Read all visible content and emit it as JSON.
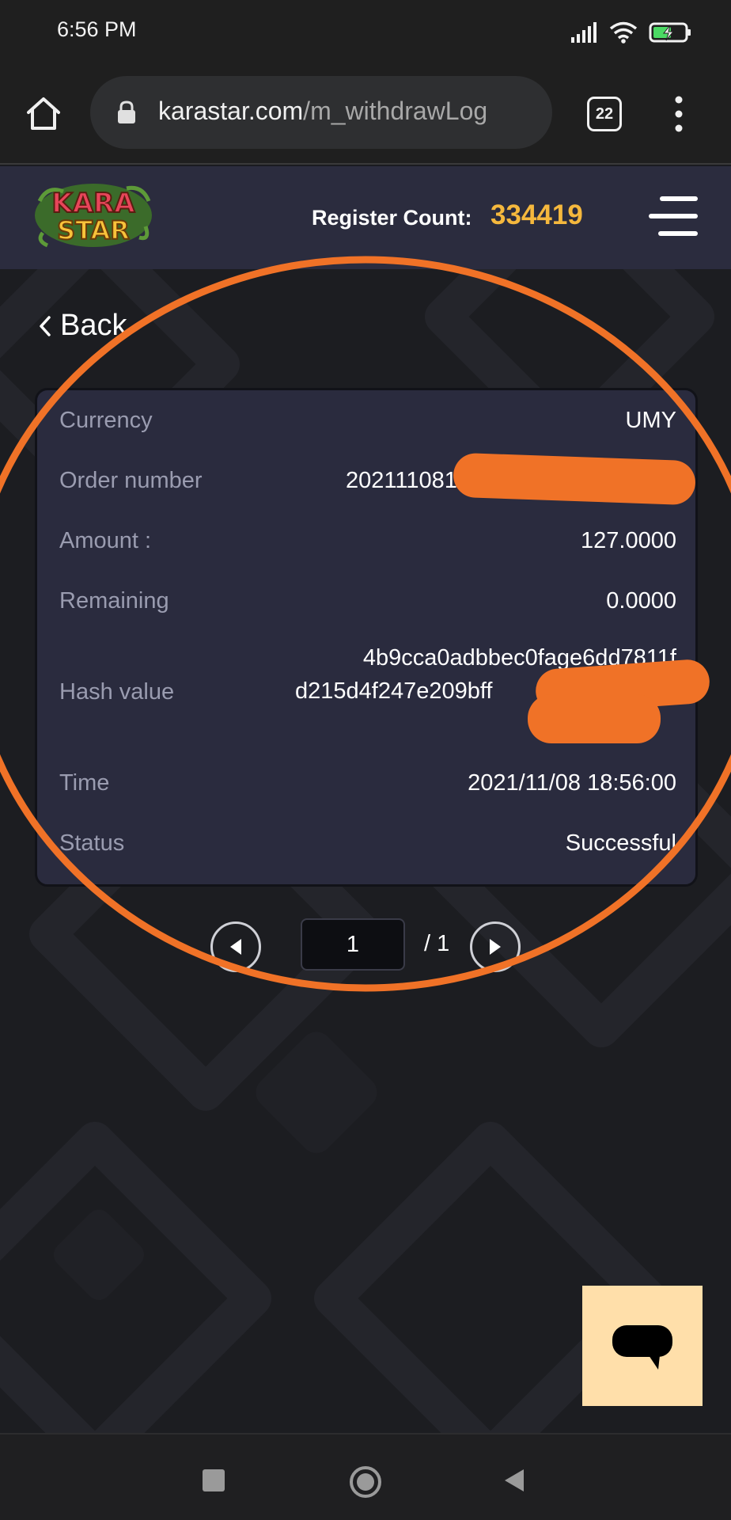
{
  "status_bar": {
    "time": "6:56 PM",
    "icons": [
      "signal-icon",
      "wifi-icon",
      "battery-charging-icon"
    ]
  },
  "browser": {
    "url_domain": "karastar.com",
    "url_path": "/m_withdrawLog",
    "tab_count": "22",
    "icons": [
      "home-icon",
      "lock-icon",
      "more-vert-icon"
    ]
  },
  "header": {
    "logo_text": [
      "KARA",
      "STAR"
    ],
    "register_label": "Register Count:",
    "register_count": "334419",
    "menu_icon": "hamburger-icon"
  },
  "back": {
    "label": "Back"
  },
  "record": {
    "currency_label": "Currency",
    "currency_value": "UMY",
    "order_label": "Order number",
    "order_value": "202111081",
    "amount_label": "Amount :",
    "amount_value": "127.0000",
    "remaining_label": "Remaining",
    "remaining_value": "0.0000",
    "hash_label": "Hash value",
    "hash_line1": "4b9cca0adbbec0fage6dd7811f",
    "hash_line2": "d215d4f247e209bff",
    "time_label": "Time",
    "time_value": "2021/11/08 18:56:00",
    "status_label": "Status",
    "status_value": "Successful"
  },
  "pagination": {
    "current_page": "1",
    "total": "/ 1"
  },
  "colors": {
    "accent_count": "#f5b83d",
    "annotation_orange": "#f07227",
    "card_bg": "#2a2b3e",
    "chat_button_bg": "#ffdfaa"
  }
}
